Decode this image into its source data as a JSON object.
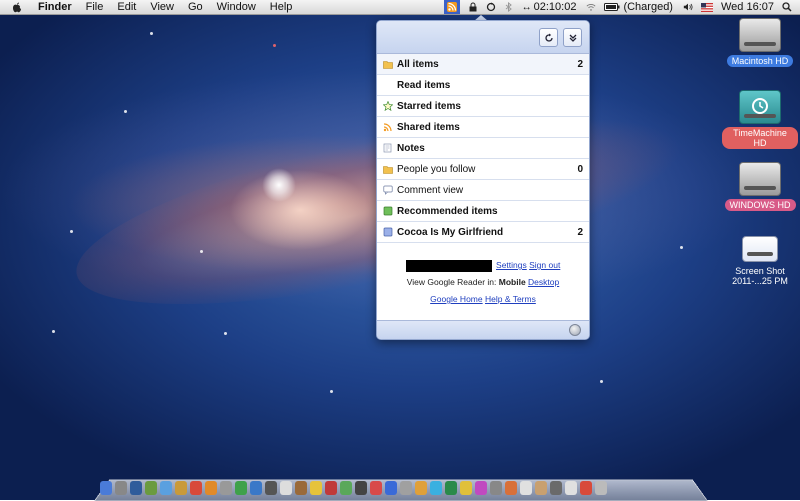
{
  "menubar": {
    "app_name": "Finder",
    "menus": [
      "File",
      "Edit",
      "View",
      "Go",
      "Window",
      "Help"
    ],
    "clock_timer": "02:10:02",
    "battery_status": "(Charged)",
    "datetime": "Wed 16:07"
  },
  "popup": {
    "items": [
      {
        "label": "All items",
        "count": "2",
        "icon": "folder-icon",
        "bold": true
      },
      {
        "label": "Read items",
        "count": "",
        "icon": "",
        "bold": true
      },
      {
        "label": "Starred items",
        "count": "",
        "icon": "star-icon",
        "bold": true
      },
      {
        "label": "Shared items",
        "count": "",
        "icon": "shared-icon",
        "bold": true
      },
      {
        "label": "Notes",
        "count": "",
        "icon": "notes-icon",
        "bold": true
      },
      {
        "label": "People you follow",
        "count": "0",
        "icon": "people-icon",
        "bold": false
      },
      {
        "label": "Comment view",
        "count": "",
        "icon": "comment-icon",
        "bold": false
      },
      {
        "label": "Recommended items",
        "count": "",
        "icon": "recommended-icon",
        "bold": true
      },
      {
        "label": "Cocoa Is My Girlfriend",
        "count": "2",
        "icon": "feed-icon",
        "bold": true
      }
    ],
    "footer": {
      "settings": "Settings",
      "sign_out": "Sign out",
      "view_in": "View Google Reader in:",
      "mobile": "Mobile",
      "desktop": "Desktop",
      "google_home": "Google Home",
      "help_terms": "Help & Terms"
    }
  },
  "desktop_icons": [
    {
      "label": "Macintosh HD"
    },
    {
      "label": "TimeMachine HD"
    },
    {
      "label": "WINDOWS HD"
    },
    {
      "label": "Screen Shot 2011-...25 PM"
    }
  ],
  "colors": {
    "popup_accent": "#c6d4ef",
    "link": "#1f3fbf",
    "menubar_reader_icon_bg": "#3b62c9",
    "timemachine_label": "#e06060",
    "macintosh_label": "#3d7be0",
    "windows_label": "#d85a88"
  }
}
